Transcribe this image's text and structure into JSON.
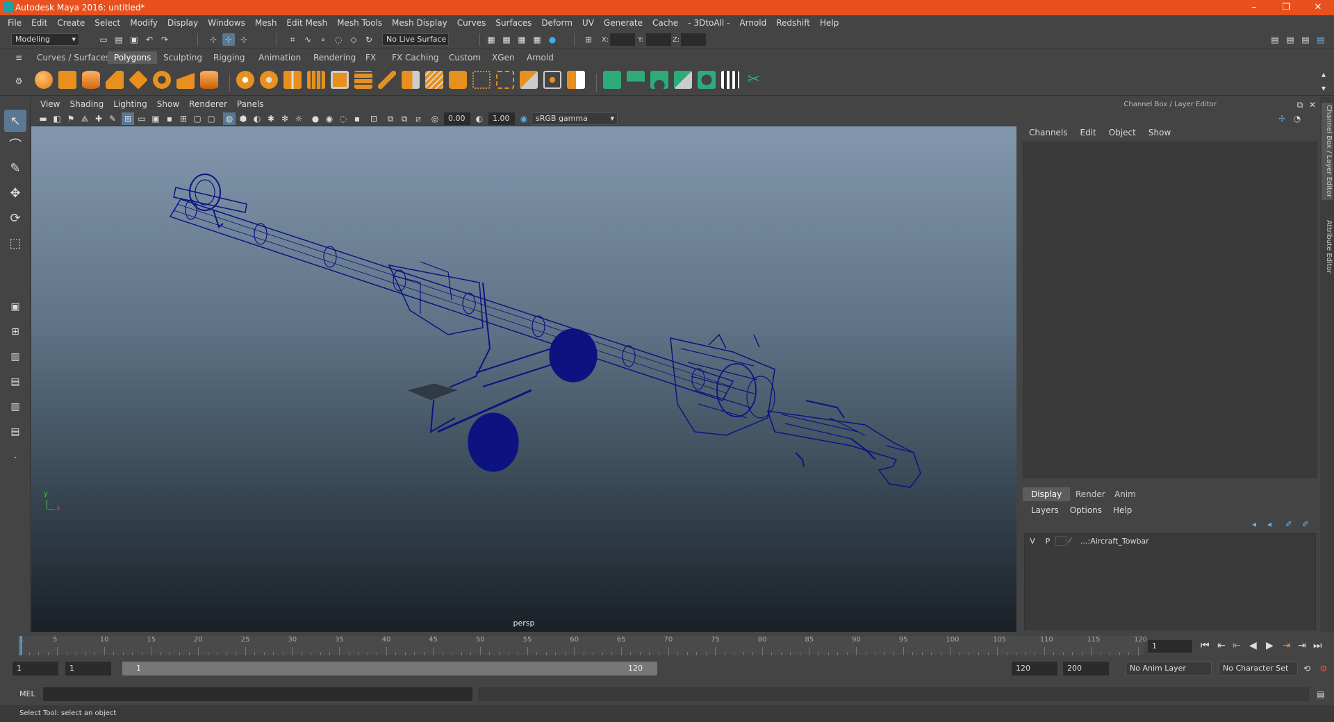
{
  "window": {
    "title": "Autodesk Maya 2016: untitled*",
    "min": "–",
    "max": "❐",
    "close": "✕"
  },
  "menu": [
    "File",
    "Edit",
    "Create",
    "Select",
    "Modify",
    "Display",
    "Windows",
    "Mesh",
    "Edit Mesh",
    "Mesh Tools",
    "Mesh Display",
    "Curves",
    "Surfaces",
    "Deform",
    "UV",
    "Generate",
    "Cache",
    "- 3DtoAll -",
    "Arnold",
    "Redshift",
    "Help"
  ],
  "statusline": {
    "mode": "Modeling",
    "live_surface": "No Live Surface",
    "x_label": "X:",
    "y_label": "Y:",
    "z_label": "Z:"
  },
  "shelf_tabs": [
    "Curves / Surfaces",
    "Polygons",
    "Sculpting",
    "Rigging",
    "Animation",
    "Rendering",
    "FX",
    "FX Caching",
    "Custom",
    "XGen",
    "Arnold"
  ],
  "active_shelf": "Polygons",
  "viewport": {
    "menu": [
      "View",
      "Shading",
      "Lighting",
      "Show",
      "Renderer",
      "Panels"
    ],
    "exposure": "0.00",
    "gamma": "1.00",
    "colorspace": "sRGB gamma",
    "camera": "persp",
    "axis_x": "x",
    "axis_y": "y"
  },
  "right_panel": {
    "title": "Channel Box / Layer Editor",
    "menu": [
      "Channels",
      "Edit",
      "Object",
      "Show"
    ],
    "tabs": [
      "Display",
      "Render",
      "Anim"
    ],
    "active_tab": "Display",
    "layer_menu": [
      "Layers",
      "Options",
      "Help"
    ],
    "layer": {
      "v": "V",
      "p": "P",
      "name": "...:Aircraft_Towbar"
    },
    "side_tabs": [
      "Channel Box / Layer Editor",
      "Attribute Editor"
    ]
  },
  "time": {
    "ticks": [
      "5",
      "10",
      "15",
      "20",
      "25",
      "30",
      "35",
      "40",
      "45",
      "50",
      "55",
      "60",
      "65",
      "70",
      "75",
      "80",
      "85",
      "90",
      "95",
      "100",
      "105",
      "110",
      "115",
      "120"
    ],
    "start_tick": "1",
    "current_frame": "1",
    "range_start": "1",
    "range_start2": "1",
    "slider_start": "1",
    "slider_end": "120",
    "range_end": "120",
    "range_end2": "200",
    "anim_layer": "No Anim Layer",
    "char_set": "No Character Set"
  },
  "cmd": {
    "label": "MEL"
  },
  "help": "Select Tool: select an object",
  "colors": {
    "title": "#e8501e",
    "wire": "#0c1380",
    "accent": "#5aa0d0"
  }
}
